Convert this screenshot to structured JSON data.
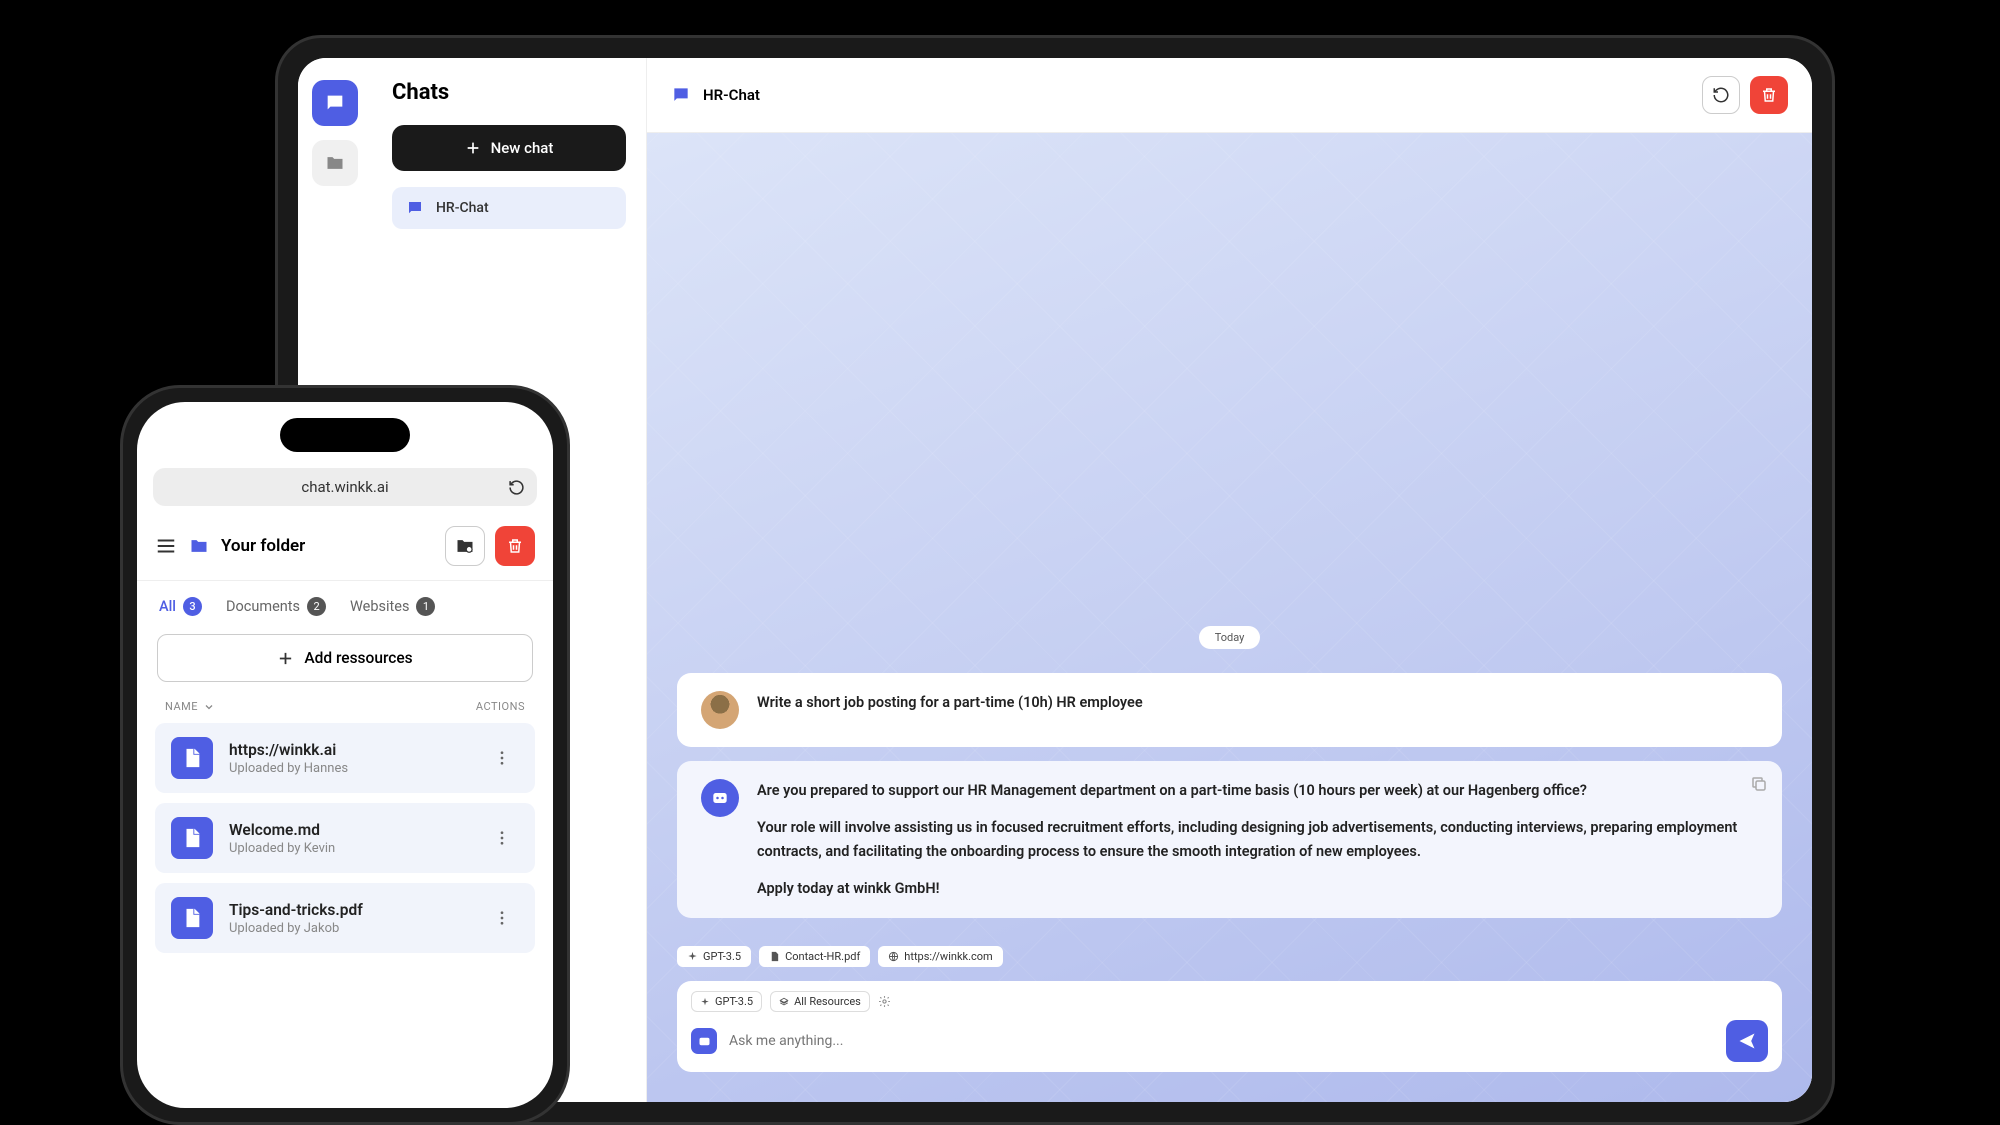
{
  "tablet": {
    "sidebar": {
      "title": "Chats",
      "new_chat_label": "New chat",
      "chats": [
        {
          "label": "HR-Chat"
        }
      ]
    },
    "header": {
      "title": "HR-Chat"
    },
    "chat": {
      "date_label": "Today",
      "user_message": "Write a short job posting for a part-time (10h) HR employee",
      "bot_p1": "Are you prepared to support our HR Management department on a part-time basis (10 hours per week) at our Hagenberg office?",
      "bot_p2": "Your role will involve assisting us in focused recruitment efforts, including designing job advertisements, conducting interviews, preparing employment contracts, and facilitating the onboarding process to ensure the smooth integration of new employees.",
      "bot_p3": "Apply today at winkk GmbH!",
      "chips": {
        "model": "GPT-3.5",
        "doc": "Contact-HR.pdf",
        "site": "https://winkk.com"
      },
      "input": {
        "model": "GPT-3.5",
        "resources": "All Resources",
        "placeholder": "Ask me anything..."
      }
    }
  },
  "phone": {
    "url": "chat.winkk.ai",
    "folder_title": "Your folder",
    "tabs": {
      "all": {
        "label": "All",
        "count": "3"
      },
      "docs": {
        "label": "Documents",
        "count": "2"
      },
      "sites": {
        "label": "Websites",
        "count": "1"
      }
    },
    "add_button": "Add ressources",
    "list_headers": {
      "name": "NAME",
      "actions": "ACTIONS"
    },
    "resources": [
      {
        "name": "https://winkk.ai",
        "meta": "Uploaded by Hannes",
        "ext": "html"
      },
      {
        "name": "Welcome.md",
        "meta": "Uploaded by Kevin",
        "ext": "md"
      },
      {
        "name": "Tips-and-tricks.pdf",
        "meta": "Uploaded by Jakob",
        "ext": "pdf"
      }
    ]
  }
}
